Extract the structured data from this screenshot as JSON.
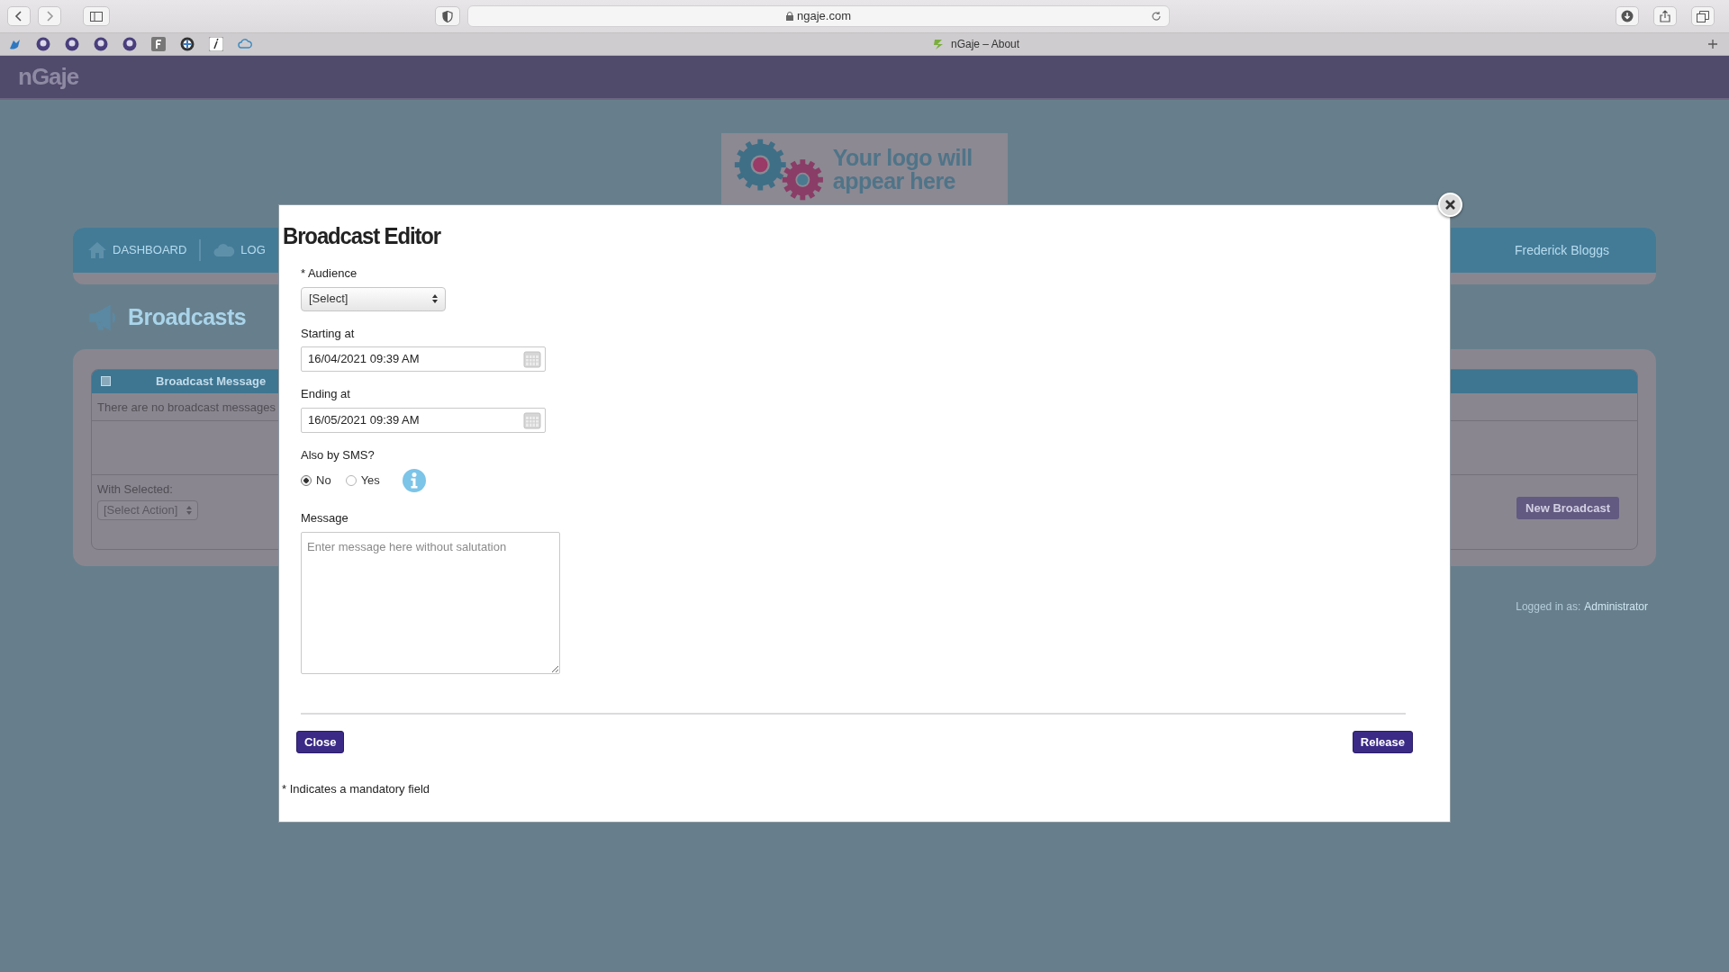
{
  "browser": {
    "url": "ngaje.com",
    "tab_title": "nGaje – About"
  },
  "app": {
    "logo": "nGaje",
    "logo_placeholder": "Your logo will appear here",
    "nav": [
      {
        "label": "DASHBOARD"
      },
      {
        "label": "LOG"
      }
    ],
    "user": "Frederick Bloggs",
    "page_title": "Broadcasts",
    "table": {
      "select_all_checked": false,
      "columns": [
        "Broadcast Message"
      ],
      "empty_text": "There are no broadcast messages"
    },
    "with_selected_label": "With Selected:",
    "action_select": "[Select Action]",
    "new_button": "New Broadcast",
    "logged_in_label": "Logged in as:",
    "logged_in_user": "Administrator"
  },
  "modal": {
    "title": "Broadcast Editor",
    "audience": {
      "label": "* Audience",
      "value": "[Select]"
    },
    "starting": {
      "label": "Starting at",
      "value": "16/04/2021 09:39 AM"
    },
    "ending": {
      "label": "Ending at",
      "value": "16/05/2021 09:39 AM"
    },
    "sms": {
      "label": "Also by SMS?",
      "options": [
        {
          "label": "No",
          "selected": true
        },
        {
          "label": "Yes",
          "selected": false
        }
      ]
    },
    "message": {
      "label": "Message",
      "placeholder": "Enter message here without salutation"
    },
    "close_button": "Close",
    "release_button": "Release",
    "footnote": "* Indicates a mandatory field"
  }
}
